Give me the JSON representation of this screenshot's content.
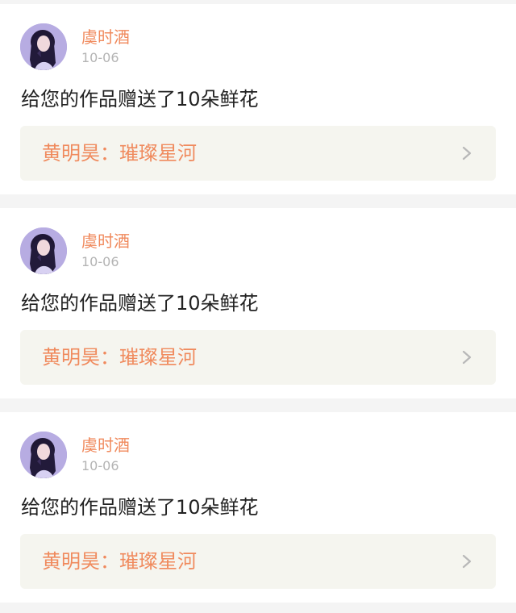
{
  "notifications": [
    {
      "username": "虞时酒",
      "date": "10-06",
      "message": "给您的作品赠送了10朵鲜花",
      "work_author": "黄明昊",
      "work_title": "璀璨星河",
      "separator": "："
    },
    {
      "username": "虞时酒",
      "date": "10-06",
      "message": "给您的作品赠送了10朵鲜花",
      "work_author": "黄明昊",
      "work_title": "璀璨星河",
      "separator": "："
    },
    {
      "username": "虞时酒",
      "date": "10-06",
      "message": "给您的作品赠送了10朵鲜花",
      "work_author": "黄明昊",
      "work_title": "璀璨星河",
      "separator": "："
    }
  ],
  "icons": {
    "avatar": "user-avatar-photo",
    "chevron": "chevron-right-icon"
  },
  "colors": {
    "accent": "#f08a5d",
    "date": "#b4b4b4",
    "card_background": "#ffffff",
    "link_background": "#f5f5ef",
    "page_background": "#f4f4f4"
  }
}
